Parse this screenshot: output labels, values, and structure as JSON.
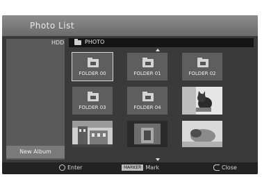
{
  "window": {
    "title": "Photo List"
  },
  "sidebar": {
    "source_label": "HDD",
    "new_album_label": "New Album"
  },
  "path": {
    "text": "PHOTO"
  },
  "grid": {
    "items": [
      {
        "type": "folder",
        "label": "FOLDER 00",
        "selected": true
      },
      {
        "type": "folder",
        "label": "FOLDER 01",
        "selected": false
      },
      {
        "type": "folder",
        "label": "FOLDER 02",
        "selected": false
      },
      {
        "type": "folder",
        "label": "FOLDER 03",
        "selected": false
      },
      {
        "type": "folder",
        "label": "FOLDER 04",
        "selected": false
      },
      {
        "type": "photo",
        "subject": "cat",
        "selected": false
      },
      {
        "type": "photo",
        "subject": "building",
        "selected": false
      },
      {
        "type": "photo",
        "subject": "interior",
        "selected": false
      },
      {
        "type": "photo",
        "subject": "animal",
        "selected": false
      }
    ]
  },
  "hints": {
    "enter_label": "Enter",
    "marker_key": "MARKER",
    "mark_label": "Mark",
    "close_label": "Close"
  }
}
